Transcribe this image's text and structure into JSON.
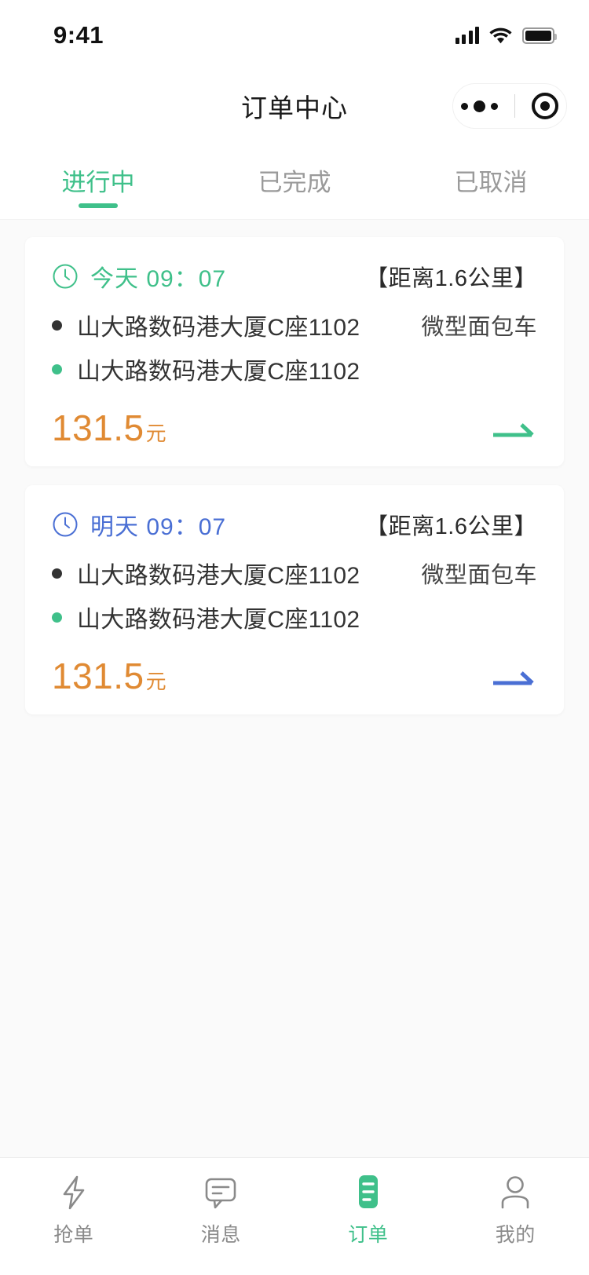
{
  "status_bar": {
    "time": "9:41",
    "signal_icon": "signal-bars-icon",
    "wifi_icon": "wifi-icon",
    "battery_icon": "battery-full-icon"
  },
  "nav_bar": {
    "title": "订单中心",
    "capsule": {
      "menu_icon": "more-dots-icon",
      "target_icon": "target-circle-icon"
    }
  },
  "tabs": {
    "active_index": 0,
    "items": [
      {
        "label": "进行中"
      },
      {
        "label": "已完成"
      },
      {
        "label": "已取消"
      }
    ]
  },
  "colors": {
    "green": "#3fc08a",
    "blue": "#4a6fd4",
    "orange": "#e08a33",
    "text_dark": "#333333",
    "text_muted": "#9a9a9a",
    "page_bg": "#fafafa"
  },
  "orders": [
    {
      "time_label": "今天",
      "time_value": "09：07",
      "time_color": "#3fc08a",
      "clock_icon": "clock-icon",
      "distance": "【距离1.6公里】",
      "pickup_address": "山大路数码港大厦C座1102",
      "dropoff_address": "山大路数码港大厦C座1102",
      "vehicle_type": "微型面包车",
      "price_amount": "131.5",
      "price_unit": "元",
      "arrow_icon": "arrow-right-icon",
      "arrow_color": "#3fc08a"
    },
    {
      "time_label": "明天",
      "time_value": "09：07",
      "time_color": "#4a6fd4",
      "clock_icon": "clock-icon",
      "distance": "【距离1.6公里】",
      "pickup_address": "山大路数码港大厦C座1102",
      "dropoff_address": "山大路数码港大厦C座1102",
      "vehicle_type": "微型面包车",
      "price_amount": "131.5",
      "price_unit": "元",
      "arrow_icon": "arrow-right-icon",
      "arrow_color": "#4a6fd4"
    }
  ],
  "bottom_nav": {
    "active_index": 2,
    "items": [
      {
        "label": "抢单",
        "icon": "lightning-bolt-icon"
      },
      {
        "label": "消息",
        "icon": "chat-bubble-icon"
      },
      {
        "label": "订单",
        "icon": "order-list-icon"
      },
      {
        "label": "我的",
        "icon": "person-icon"
      }
    ]
  }
}
